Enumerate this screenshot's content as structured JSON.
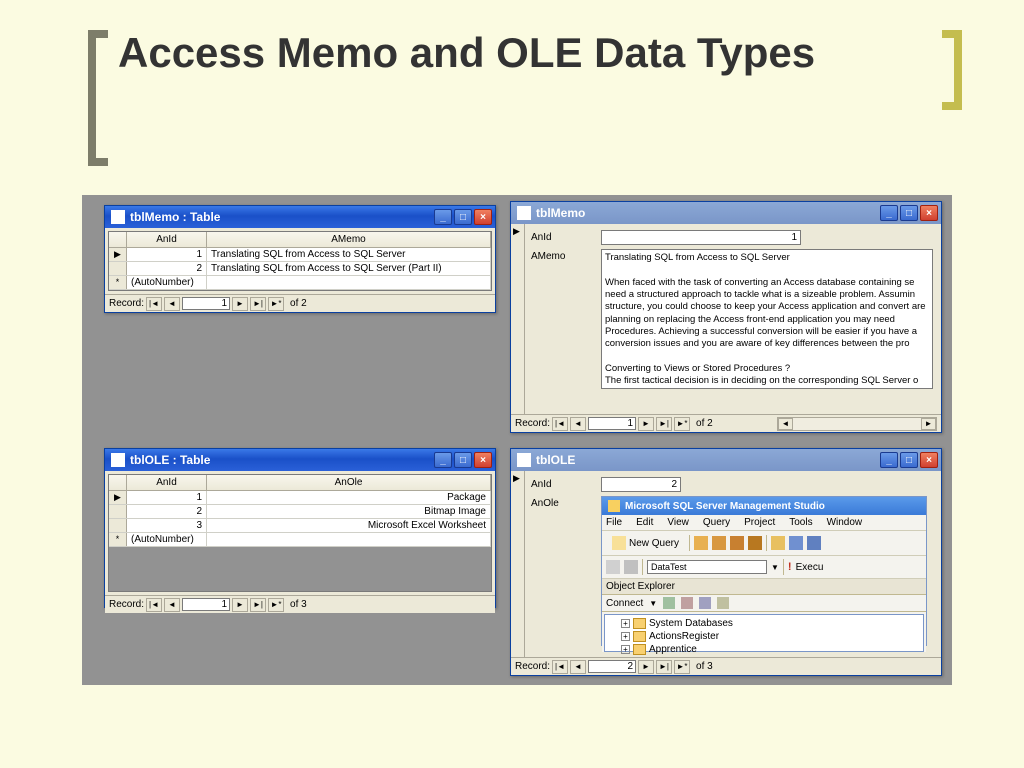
{
  "slide_title": "Access Memo and OLE Data Types",
  "windows": {
    "tblmemo_table": {
      "title": "tblMemo : Table",
      "columns": [
        "AnId",
        "AMemo"
      ],
      "rows": [
        {
          "id": "1",
          "memo": "Translating SQL from Access to SQL Server"
        },
        {
          "id": "2",
          "memo": "Translating SQL from Access to SQL Server (Part II)"
        }
      ],
      "autonumber": "(AutoNumber)",
      "nav": {
        "label": "Record:",
        "pos": "1",
        "of": "of  2"
      }
    },
    "tblmemo_form": {
      "title": "tblMemo",
      "fields": {
        "anid_label": "AnId",
        "anid_value": "1",
        "amemo_label": "AMemo"
      },
      "memo_text": "Translating SQL from Access to SQL Server\n\nWhen faced with the task of converting an Access database containing se need a structured approach to tackle what is a sizeable problem. Assumin structure, you could choose to keep your Access application and convert are planning on replacing the Access front-end application you may need Procedures. Achieving a successful conversion will be easier if you have a conversion issues and you are aware of key differences between the pro\n\nConverting to Views or Stored Procedures ?\nThe first tactical decision is in deciding on the corresponding SQL Server o UPDATE, DELETE, MAKE-TABLE or DDL query, then the equivalent object (Views can not be used in this case), other types of query such as SELECT converted to Views (these could also be converted to Stored Procedures",
      "nav": {
        "label": "Record:",
        "pos": "1",
        "of": "of  2"
      }
    },
    "tblole_table": {
      "title": "tblOLE : Table",
      "columns": [
        "AnId",
        "AnOle"
      ],
      "rows": [
        {
          "id": "1",
          "ole": "Package"
        },
        {
          "id": "2",
          "ole": "Bitmap Image"
        },
        {
          "id": "3",
          "ole": "Microsoft Excel Worksheet"
        }
      ],
      "autonumber": "(AutoNumber)",
      "nav": {
        "label": "Record:",
        "pos": "1",
        "of": "of  3"
      }
    },
    "tblole_form": {
      "title": "tblOLE",
      "fields": {
        "anid_label": "AnId",
        "anid_value": "2",
        "anole_label": "AnOle"
      },
      "nav": {
        "label": "Record:",
        "pos": "2",
        "of": "of  3"
      },
      "ssms": {
        "title": "Microsoft SQL Server Management Studio",
        "menu": [
          "File",
          "Edit",
          "View",
          "Query",
          "Project",
          "Tools",
          "Window"
        ],
        "newquery": "New Query",
        "datatest": "DataTest",
        "execute": "Execu",
        "oe_title": "Object Explorer",
        "connect": "Connect",
        "tree": [
          "System Databases",
          "ActionsRegister",
          "Apprentice"
        ]
      }
    }
  }
}
